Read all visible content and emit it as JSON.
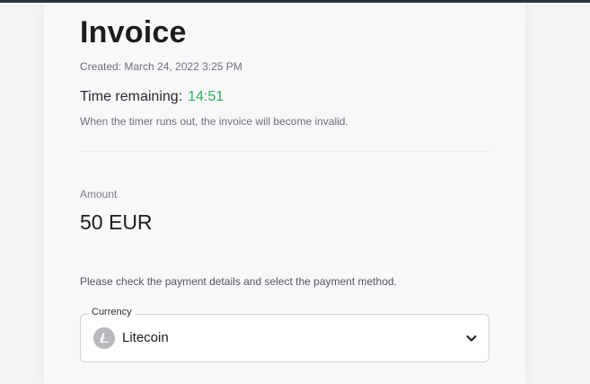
{
  "invoice": {
    "title": "Invoice",
    "created": "Created: March 24, 2022 3:25 PM",
    "time_remaining_label": "Time remaining:",
    "time_remaining_value": "14:51",
    "timer_note": "When the timer runs out, the invoice will become invalid."
  },
  "amount": {
    "label": "Amount",
    "value": "50 EUR"
  },
  "payment": {
    "instructions": "Please check the payment details and select the payment method.",
    "currency_legend": "Currency",
    "selected_currency": "Litecoin",
    "selected_icon": "litecoin-icon",
    "dropdown_icon": "chevron-down-icon"
  },
  "colors": {
    "timer": "#2fae61",
    "topbar": "#2b3340",
    "card_bg": "#f8f8fb",
    "coin": "#b8b8bd"
  }
}
